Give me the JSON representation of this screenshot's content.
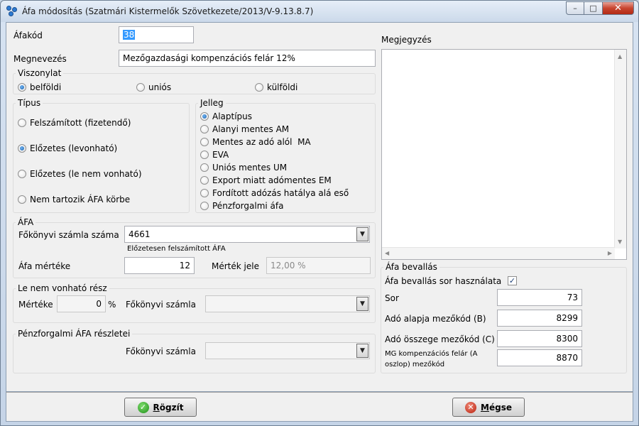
{
  "window": {
    "title": "Áfa módosítás (Szatmári Kistermelők Szövetkezete/2013/V-9.13.8.7)",
    "buttons": {
      "minimize": "–",
      "maximize": "□",
      "close": "✕"
    }
  },
  "form": {
    "afakod": {
      "label": "Áfakód",
      "value": "38"
    },
    "megnevezes": {
      "label": "Megnevezés",
      "value": "Mezőgazdasági kompenzációs felár 12%"
    },
    "viszonylat": {
      "title": "Viszonylat",
      "options": [
        {
          "label": "belföldi",
          "selected": true
        },
        {
          "label": "uniós",
          "selected": false
        },
        {
          "label": "külföldi",
          "selected": false
        }
      ]
    },
    "tipus": {
      "title": "Típus",
      "options": [
        {
          "label": "Felszámított (fizetendő)",
          "selected": false
        },
        {
          "label": "Előzetes (levonható)",
          "selected": true
        },
        {
          "label": "Előzetes (le nem vonható)",
          "selected": false
        },
        {
          "label": "Nem tartozik ÁFA körbe",
          "selected": false
        }
      ]
    },
    "jelleg": {
      "title": "Jelleg",
      "options": [
        {
          "label": "Alaptípus",
          "selected": true
        },
        {
          "label": "Alanyi mentes AM",
          "selected": false
        },
        {
          "label": "Mentes az adó alól  MA",
          "selected": false
        },
        {
          "label": "EVA",
          "selected": false
        },
        {
          "label": "Uniós mentes UM",
          "selected": false
        },
        {
          "label": "Export miatt adómentes EM",
          "selected": false
        },
        {
          "label": "Fordított adózás hatálya alá eső",
          "selected": false
        },
        {
          "label": "Pénzforgalmi áfa",
          "selected": false
        }
      ]
    },
    "afa": {
      "title": "ÁFA",
      "fokonyvi_label": "Főkönyvi számla száma",
      "fokonyvi_value": "4661",
      "fokonyvi_desc": "Előzetesen felszámított ÁFA",
      "merteke_label": "Áfa mértéke",
      "merteke_value": "12",
      "jele_label": "Mérték jele",
      "jele_value": "12,00 %"
    },
    "le_nem_vonhato": {
      "title": "Le nem vonható rész",
      "merteke_label": "Mértéke",
      "merteke_value": "0",
      "percent": "%",
      "fokonyvi_label": "Főkönyvi számla",
      "fokonyvi_value": ""
    },
    "penzforgalmi": {
      "title": "Pénzforgalmi ÁFA részletei",
      "fokonyvi_label": "Főkönyvi számla",
      "fokonyvi_value": ""
    },
    "megjegyzes": {
      "label": "Megjegyzés",
      "value": ""
    },
    "bevallas": {
      "title": "Áfa bevallás",
      "sor_hasznalata_label": "Áfa bevallás sor használata",
      "sor_hasznalata_checked": "✓",
      "sor_label": "Sor",
      "sor_value": "73",
      "alap_label": "Adó alapja mezőkód (B)",
      "alap_value": "8299",
      "osszeg_label": "Adó összege mezőkód (C)",
      "osszeg_value": "8300",
      "mg_label_line1": "MG kompenzációs felár (A",
      "mg_label_line2": "oszlop) mezőkód",
      "mg_value": "8870"
    }
  },
  "footer": {
    "save_ul": "R",
    "save_rest": "ögzít",
    "cancel_ul": "M",
    "cancel_rest": "égse"
  },
  "icons": {
    "combo_arrow": "▼",
    "ok": "✓",
    "cancel": "✕",
    "scroll_up": "▲",
    "scroll_down": "▼",
    "scroll_left": "◀",
    "scroll_right": "▶"
  }
}
